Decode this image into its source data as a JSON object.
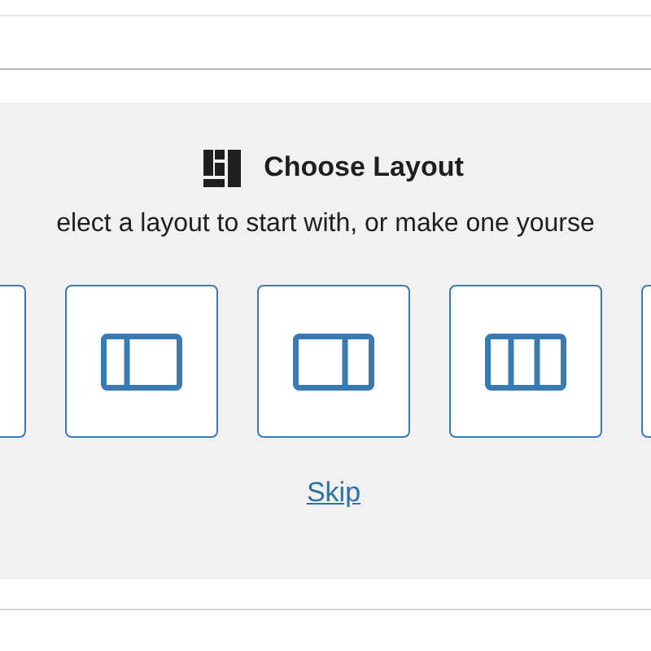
{
  "placeholder": {
    "title": "Choose Layout",
    "instructions": "elect a layout to start with, or make one yourse",
    "layouts": [
      {
        "kind": "cut-off"
      },
      {
        "kind": "third-two-thirds"
      },
      {
        "kind": "two-thirds-third"
      },
      {
        "kind": "three-thirds"
      },
      {
        "kind": "cut-off"
      }
    ],
    "skip": "Skip"
  }
}
